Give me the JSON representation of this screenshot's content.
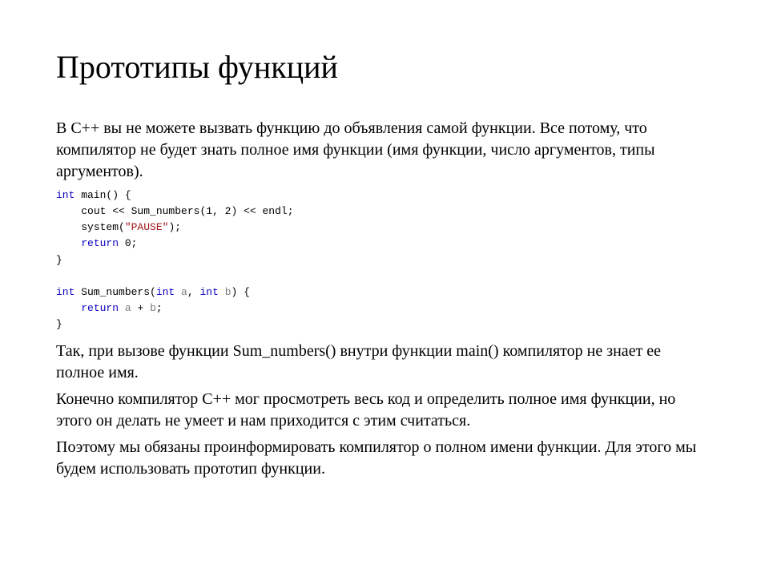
{
  "title": "Прототипы функций",
  "para1": "В C++ вы не можете вызвать функцию до объявления самой функции. Все потому, что компилятор не будет знать полное имя функции (имя функции, число аргументов, типы аргументов).",
  "code": {
    "l1": {
      "kw": "int",
      "rest": " main() {"
    },
    "l2": {
      "indent": "    ",
      "a": "cout << Sum_numbers(",
      "n1": "1",
      "c": ", ",
      "n2": "2",
      "b": ") << endl;"
    },
    "l3": {
      "indent": "    ",
      "a": "system(",
      "str": "\"PAUSE\"",
      "b": ");"
    },
    "l4": {
      "indent": "    ",
      "kw": "return",
      "rest": " 0;"
    },
    "l5": "}",
    "blank": "",
    "l6": {
      "kw1": "int",
      "a": " Sum_numbers(",
      "kw2": "int",
      "sp1": " ",
      "v1": "a",
      "c": ", ",
      "kw3": "int",
      "sp2": " ",
      "v2": "b",
      "b": ") {"
    },
    "l7": {
      "indent": "    ",
      "kw": "return",
      "sp": " ",
      "v1": "a",
      "op": " + ",
      "v2": "b",
      "end": ";"
    },
    "l8": "}"
  },
  "para2": "Так, при вызове функции Sum_numbers() внутри функции main() компилятор не знает ее полное имя.",
  "para3": "Конечно компилятор C++ мог просмотреть весь код и определить полное имя функции, но этого он делать не умеет и нам приходится с этим считаться.",
  "para4": "Поэтому мы обязаны проинформировать компилятор о полном имени функции. Для этого мы будем использовать прототип функции."
}
